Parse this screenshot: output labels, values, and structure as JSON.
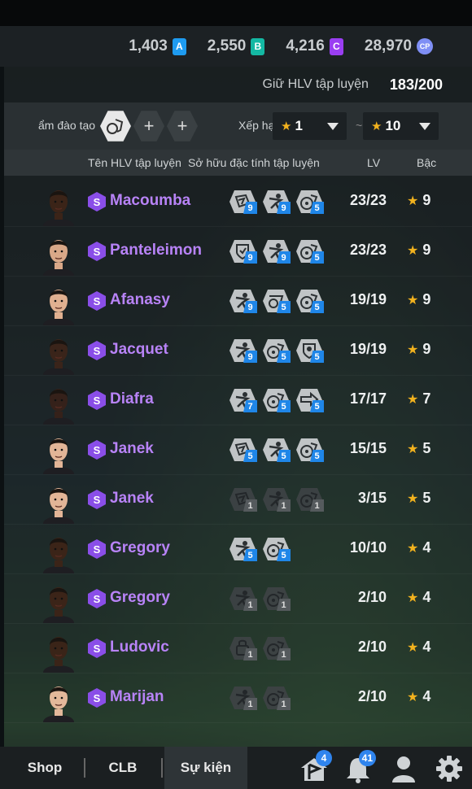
{
  "currency": [
    {
      "value": "1,403",
      "badge": "A",
      "color": "#1e9bf0"
    },
    {
      "value": "2,550",
      "badge": "B",
      "color": "#14b8a3"
    },
    {
      "value": "4,216",
      "badge": "C",
      "color": "#9a3ef2"
    },
    {
      "value": "28,970",
      "badge": "CP",
      "color": "#7f8ff5"
    }
  ],
  "slots": {
    "label": "Giữ HLV tập luyện",
    "value": "183/200"
  },
  "filter": {
    "label": "ẩm đào tạo",
    "sort_label": "Xếp hạ",
    "min_rank": "1",
    "max_rank": "10"
  },
  "columns": {
    "name": "Tên HLV tập luyện",
    "traits": "Sở hữu đặc tính tập luyện",
    "lv": "LV",
    "rank": "Bậc"
  },
  "coaches": [
    {
      "name": "Macoumba",
      "grade": "S",
      "skin": "#3b2418",
      "traits": [
        {
          "icon": "chart-icon",
          "lvl": "9"
        },
        {
          "icon": "player-icon",
          "lvl": "9"
        },
        {
          "icon": "ball-icon",
          "lvl": "5"
        }
      ],
      "lv": "23/23",
      "rank": "9"
    },
    {
      "name": "Panteleimon",
      "grade": "S",
      "skin": "#d9a888",
      "traits": [
        {
          "icon": "shield-icon",
          "lvl": "9"
        },
        {
          "icon": "player-icon",
          "lvl": "9"
        },
        {
          "icon": "ball-icon",
          "lvl": "5"
        }
      ],
      "lv": "23/23",
      "rank": "9"
    },
    {
      "name": "Afanasy",
      "grade": "S",
      "skin": "#e0b090",
      "traits": [
        {
          "icon": "player-icon",
          "lvl": "9"
        },
        {
          "icon": "dribble-icon",
          "lvl": "5"
        },
        {
          "icon": "ball-icon",
          "lvl": "5"
        }
      ],
      "lv": "19/19",
      "rank": "9"
    },
    {
      "name": "Jacquet",
      "grade": "S",
      "skin": "#3a241a",
      "traits": [
        {
          "icon": "player-icon",
          "lvl": "9"
        },
        {
          "icon": "ball-icon",
          "lvl": "5"
        },
        {
          "icon": "goalkeeper-icon",
          "lvl": "5"
        }
      ],
      "lv": "19/19",
      "rank": "9"
    },
    {
      "name": "Diafra",
      "grade": "S",
      "skin": "#35211a",
      "traits": [
        {
          "icon": "player-icon",
          "lvl": "7"
        },
        {
          "icon": "ball-icon",
          "lvl": "5"
        },
        {
          "icon": "pass-icon",
          "lvl": "5"
        }
      ],
      "lv": "17/17",
      "rank": "7"
    },
    {
      "name": "Janek",
      "grade": "S",
      "skin": "#e2b597",
      "traits": [
        {
          "icon": "chart-icon",
          "lvl": "5"
        },
        {
          "icon": "player-icon",
          "lvl": "5"
        },
        {
          "icon": "ball-icon",
          "lvl": "5"
        }
      ],
      "lv": "15/15",
      "rank": "5"
    },
    {
      "name": "Janek",
      "grade": "S",
      "skin": "#e2b597",
      "traits": [
        {
          "icon": "chart-icon",
          "lvl": "1",
          "dim": true
        },
        {
          "icon": "player-icon",
          "lvl": "1",
          "dim": true
        },
        {
          "icon": "ball-icon",
          "lvl": "1",
          "dim": true
        }
      ],
      "lv": "3/15",
      "rank": "5"
    },
    {
      "name": "Gregory",
      "grade": "S",
      "skin": "#3b2418",
      "traits": [
        {
          "icon": "player-icon",
          "lvl": "5"
        },
        {
          "icon": "ball-icon",
          "lvl": "5"
        }
      ],
      "lv": "10/10",
      "rank": "4"
    },
    {
      "name": "Gregory",
      "grade": "S",
      "skin": "#3b2418",
      "traits": [
        {
          "icon": "player-icon",
          "lvl": "1",
          "dim": true
        },
        {
          "icon": "ball-icon",
          "lvl": "1",
          "dim": true
        }
      ],
      "lv": "2/10",
      "rank": "4"
    },
    {
      "name": "Ludovic",
      "grade": "S",
      "skin": "#3a2418",
      "traits": [
        {
          "icon": "lock-icon",
          "lvl": "1",
          "dim": true
        },
        {
          "icon": "ball-icon",
          "lvl": "1",
          "dim": true
        }
      ],
      "lv": "2/10",
      "rank": "4"
    },
    {
      "name": "Marijan",
      "grade": "S",
      "skin": "#e3b89a",
      "traits": [
        {
          "icon": "player-icon",
          "lvl": "1",
          "dim": true
        },
        {
          "icon": "ball-icon",
          "lvl": "1",
          "dim": true
        }
      ],
      "lv": "2/10",
      "rank": "4"
    }
  ],
  "bottom_nav": {
    "tabs": [
      "Shop",
      "CLB",
      "Sự kiện"
    ],
    "flag_count": "4",
    "bell_count": "41"
  }
}
